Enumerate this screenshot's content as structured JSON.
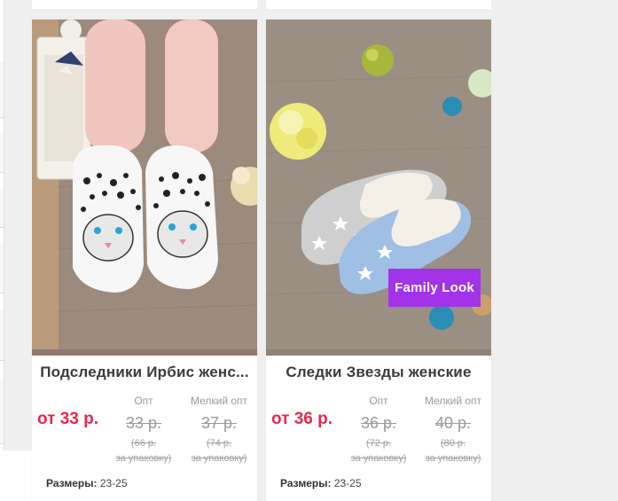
{
  "products": [
    {
      "title": "Подследники Ирбис женс...",
      "price_from": "от 33 р.",
      "tiers": [
        {
          "label": "Опт",
          "price": "33 р.",
          "pack_line1": "(66 р.",
          "pack_line2": "за упаковку)"
        },
        {
          "label": "Мелкий опт",
          "price": "37 р.",
          "pack_line1": "(74 р.",
          "pack_line2": "за упаковку)"
        }
      ],
      "sizes_label": "Размеры:",
      "sizes_value": "23-25",
      "badge": null
    },
    {
      "title": "Следки Звезды женские",
      "price_from": "от 36 р.",
      "tiers": [
        {
          "label": "Опт",
          "price": "36 р.",
          "pack_line1": "(72 р.",
          "pack_line2": "за упаковку)"
        },
        {
          "label": "Мелкий опт",
          "price": "40 р.",
          "pack_line1": "(80 р.",
          "pack_line2": "за упаковку)"
        }
      ],
      "sizes_label": "Размеры:",
      "sizes_value": "23-25",
      "badge": "Family Look"
    }
  ],
  "colors": {
    "price_accent": "#e8294a",
    "badge_bg": "#a233e8",
    "struck_price": "#9b9b9b"
  }
}
